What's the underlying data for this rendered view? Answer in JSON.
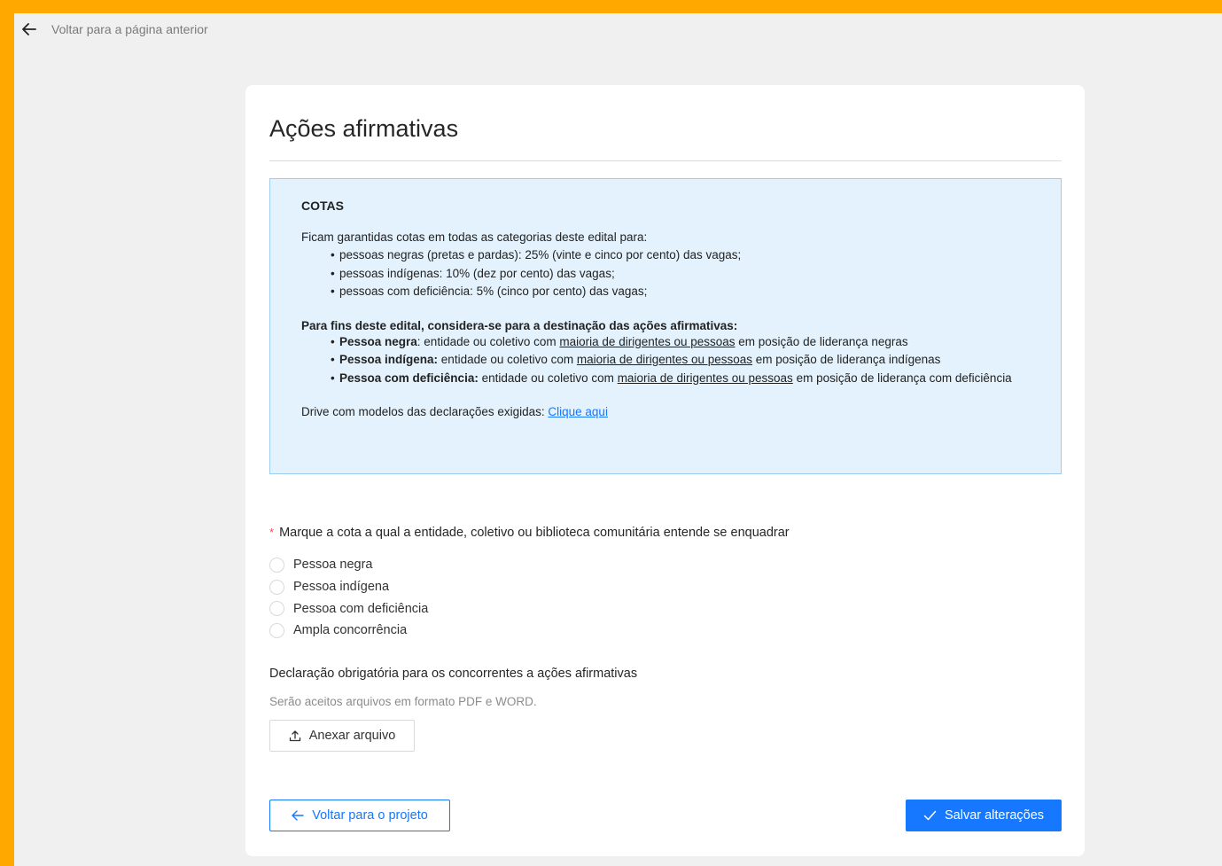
{
  "nav": {
    "back_label": "Voltar para a página anterior"
  },
  "page": {
    "title": "Ações afirmativas"
  },
  "info": {
    "heading": "COTAS",
    "intro": "Ficam garantidas cotas em todas as categorias deste edital para:",
    "quotas": [
      "pessoas negras (pretas e pardas): 25% (vinte e cinco por cento) das vagas;",
      "pessoas indígenas: 10% (dez por cento) das vagas;",
      "pessoas com deficiência: 5% (cinco por cento) das vagas;"
    ],
    "destination_lead": "Para fins deste edital, considera-se para a destinação das ações afirmativas:",
    "definitions": [
      {
        "term": "Pessoa negra",
        "pre": ": entidade ou coletivo com ",
        "link": "maioria de dirigentes ou pessoas",
        "post": " em posição de liderança negras"
      },
      {
        "term": "Pessoa indígena:",
        "pre": " entidade ou coletivo com ",
        "link": "maioria de dirigentes ou pessoas",
        "post": " em posição de liderança indígenas"
      },
      {
        "term": "Pessoa com deficiência:",
        "pre": " entidade ou coletivo com ",
        "link": "maioria de dirigentes ou pessoas",
        "post": " em posição de liderança com deficiência"
      }
    ],
    "drive_text": "Drive com modelos das declarações exigidas: ",
    "drive_link": "Clique aqui"
  },
  "question": {
    "required_mark": "*",
    "label": "Marque a cota a qual a entidade, coletivo ou biblioteca comunitária entende se enquadrar",
    "options": [
      "Pessoa negra",
      "Pessoa indígena",
      "Pessoa com deficiência",
      "Ampla concorrência"
    ]
  },
  "declaration": {
    "title": "Declaração obrigatória para os concorrentes a ações afirmativas",
    "hint": "Serão aceitos arquivos em formato PDF e WORD.",
    "attach_label": "Anexar arquivo"
  },
  "footer": {
    "back_label": "Voltar para o projeto",
    "save_label": "Salvar alterações"
  },
  "colors": {
    "accent": "#1677ff",
    "frame": "#ffa800",
    "info_bg": "#e3f2fc"
  }
}
